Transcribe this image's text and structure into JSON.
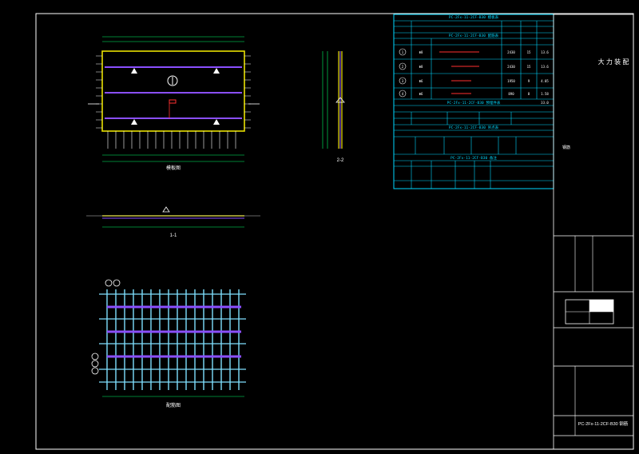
{
  "title_block": {
    "company": "大 力 装 配",
    "drawing_no": "PC-2Fx-11-2CF-B30 钢筋",
    "sheet_label": "钢筋"
  },
  "views": {
    "plan_label": "模板图",
    "section_1": "1-1",
    "section_2": "2-2",
    "rebar_plan_label": "配筋图"
  },
  "tables": {
    "panel_table_title": "PC-2Fx-11-2CF-B30 模板表",
    "rebar_table_title": "PC-2Fx-11-2CF-B30 配筋表",
    "embed_table_title": "PC-2Fx-11-2CF-B30 预埋件表",
    "lift_table_title": "PC-2Fx-11-2CF-B30 吊点表",
    "note_table_title": "PC-2Fx-11-2CF-B30 备注",
    "rebar_rows": [
      {
        "id": "1",
        "spec": "Φ8",
        "len": "2430",
        "qty": "15",
        "wt": "13.6"
      },
      {
        "id": "2",
        "spec": "Φ8",
        "len": "2430",
        "qty": "15",
        "wt": "13.6"
      },
      {
        "id": "3",
        "spec": "Φ6",
        "len": "1950",
        "qty": "9",
        "wt": "4.05"
      },
      {
        "id": "4",
        "spec": "Φ6",
        "len": "890",
        "qty": "8",
        "wt": "1.58"
      }
    ],
    "total": "33.0"
  }
}
